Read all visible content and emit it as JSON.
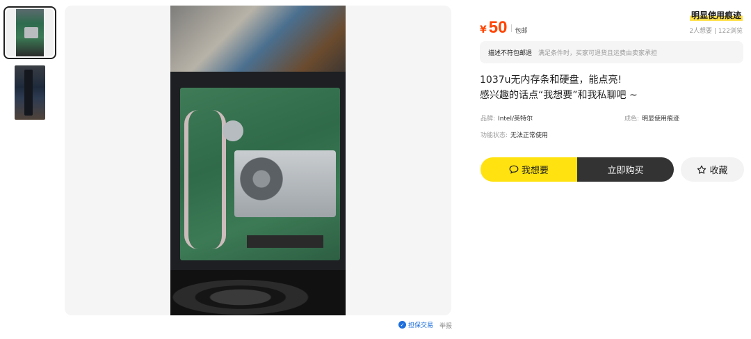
{
  "gallery": {
    "thumbnails": [
      "主图1",
      "主图2"
    ],
    "guarantee_label": "担保交易",
    "guarantee_icon": "shield-icon",
    "report_label": "举报"
  },
  "product": {
    "currency": "¥",
    "price": "50",
    "shipping": "包邮",
    "condition_badge": "明显使用痕迹",
    "stats": "2人想要 | 122浏览",
    "notice_title": "描述不符包邮退",
    "notice_detail": "满足条件时，买家可退货且运费由卖家承担",
    "description_line1": "1037u无内存条和硬盘，能点亮!",
    "description_line2": "感兴趣的话点“我想要”和我私聊吧 ~",
    "attributes": {
      "brand_label": "品牌:",
      "brand_value": "Intel/英特尔",
      "condition_label": "成色:",
      "condition_value": "明显使用痕迹",
      "function_label": "功能状态:",
      "function_value": "无法正常使用"
    }
  },
  "actions": {
    "want_label": "我想要",
    "want_icon": "chat-bubble-icon",
    "buy_label": "立即购买",
    "favorite_label": "收藏",
    "favorite_icon": "star-icon"
  },
  "colors": {
    "price": "#ff4400",
    "want_button": "#ffe20f",
    "buy_button": "#333333",
    "guarantee": "#1e6fdc"
  }
}
